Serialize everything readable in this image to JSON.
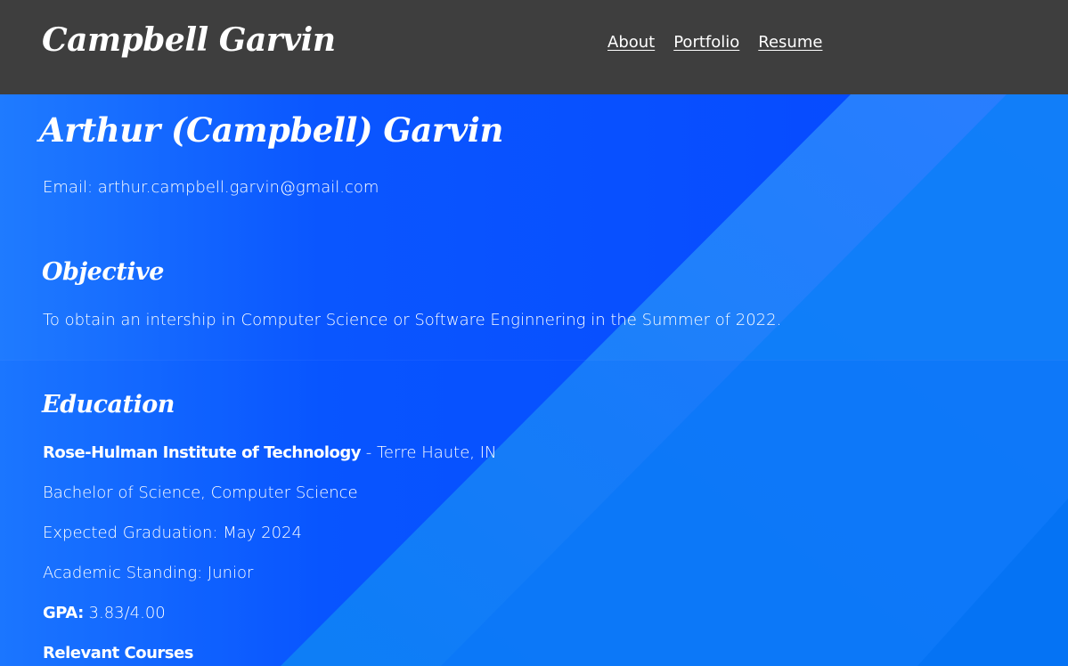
{
  "header": {
    "brand": "Campbell Garvin",
    "nav": [
      "About",
      "Portfolio",
      "Resume"
    ]
  },
  "resume": {
    "name": "Arthur (Campbell) Garvin",
    "email_label": "Email:",
    "email": "arthur.campbell.garvin@gmail.com",
    "objective": {
      "title": "Objective",
      "text": "To obtain an intership in Computer Science or Software Enginnering in the Summer of 2022."
    },
    "education": {
      "title": "Education",
      "school": "Rose-Hulman Institute of Technology",
      "location": "- Terre Haute, IN",
      "degree": "Bachelor of Science, Computer Science",
      "graduation": "Expected Graduation: May 2024",
      "standing": "Academic Standing: Junior",
      "gpa_label": "GPA:",
      "gpa_value": "3.83/4.00",
      "courses_label": "Relevant Courses"
    }
  },
  "colors": {
    "header_bg": "#3e3e3e",
    "primary_blue": "#1a74ff",
    "deep_blue": "#0547ff",
    "text": "#ffffff"
  }
}
